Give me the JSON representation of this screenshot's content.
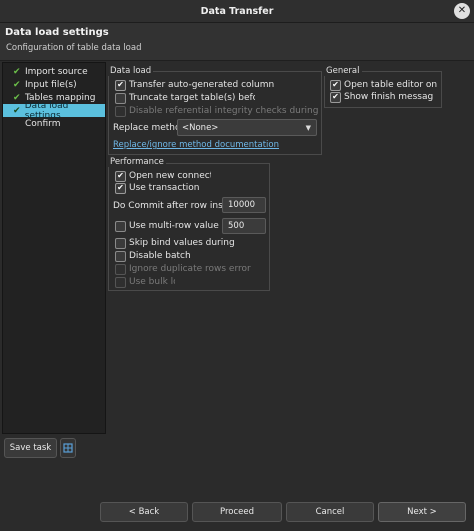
{
  "window": {
    "title": "Data Transfer",
    "close_glyph": "✕"
  },
  "header": {
    "title": "Data load settings",
    "subtitle": "Configuration of table data load"
  },
  "steps": [
    {
      "label": "Import source",
      "done": true
    },
    {
      "label": "Input file(s)",
      "done": true
    },
    {
      "label": "Tables mapping",
      "done": true
    },
    {
      "label": "Data load settings",
      "done": true,
      "active": true
    },
    {
      "label": "Confirm",
      "done": false
    }
  ],
  "data_load": {
    "label": "Data load",
    "transfer_auto": "Transfer auto-generated column",
    "truncate": "Truncate target table(s) before loa",
    "disable_ref": "Disable referential integrity checks during the transfe",
    "replace_label": "Replace method:",
    "replace_value": "<None>",
    "doc_link": "Replace/ignore method documentation"
  },
  "general": {
    "label": "General",
    "open_editor": "Open table editor on finisl",
    "show_finish": "Show finish messag"
  },
  "performance": {
    "label": "Performance",
    "open_conn": "Open new connection(s",
    "use_tx": "Use transaction",
    "commit_label": "Do Commit after row insert:",
    "commit_value": "10000",
    "multirow": "Use multi-row value inser",
    "multirow_value": "500",
    "skip_bind": "Skip bind values during inser",
    "disable_batch": "Disable batch",
    "ignore_dup": "Ignore duplicate rows error",
    "bulk_load": "Use bulk load"
  },
  "buttons": {
    "save_task": "Save task",
    "back": "< Back",
    "proceed": "Proceed",
    "cancel": "Cancel",
    "next": "Next >"
  },
  "glyphs": {
    "check": "✔",
    "arrow": "▼"
  },
  "colors": {
    "accent": "#5bc0de",
    "check_green": "#6cc04a",
    "link": "#6fb8e8"
  }
}
